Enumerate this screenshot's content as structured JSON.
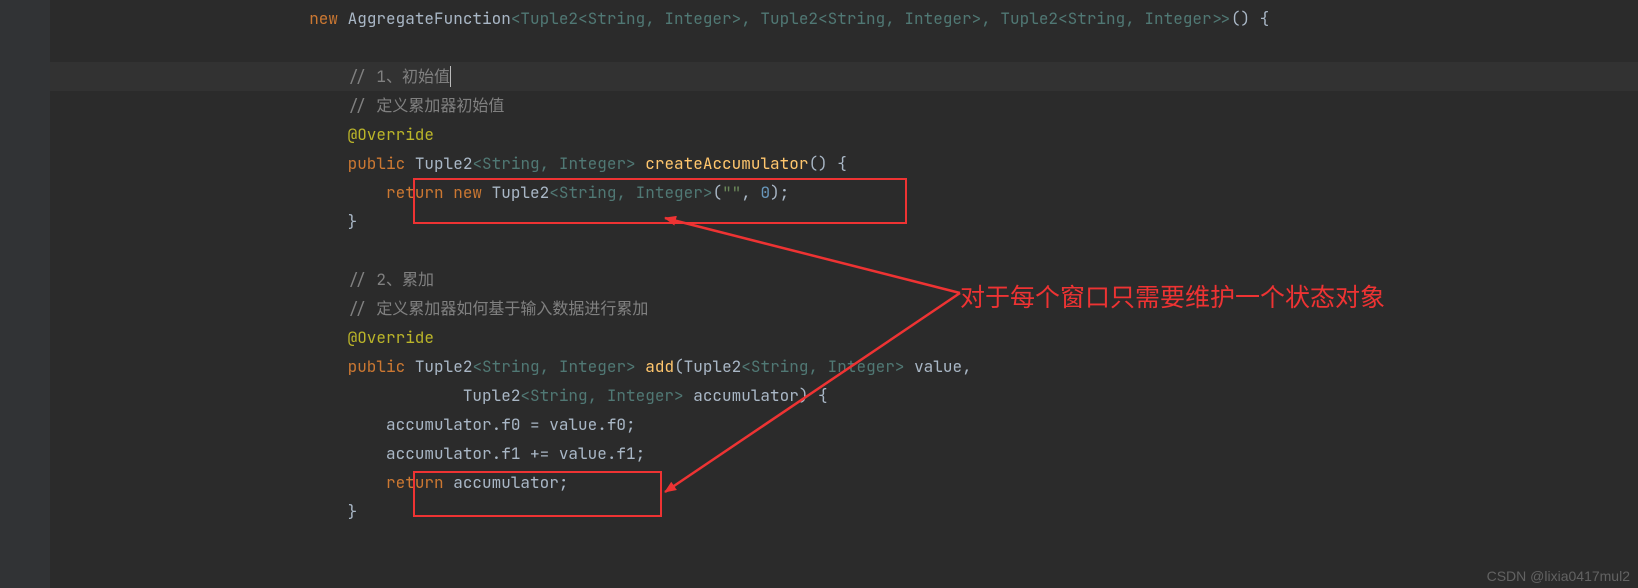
{
  "code": {
    "l1_pre": "                           ",
    "l1_kw": "new",
    "l1_sp": " ",
    "l1_cls": "AggregateFunction",
    "l1_gen": "<Tuple2<String, Integer>, Tuple2<String, Integer>, Tuple2<String, Integer>>",
    "l1_tail": "() {",
    "indent3": "                               ",
    "indent4": "                                   ",
    "indent5": "                                           ",
    "c1": "// 1、初始值",
    "c2": "// 定义累加器初始值",
    "at": "@Override",
    "m1_kw": "public",
    "m1_sp": " ",
    "m1_ret": "Tuple2",
    "m1_gen": "<String, Integer>",
    "m1_sp2": " ",
    "m1_name": "createAccumulator",
    "m1_tail": "() {",
    "r1_kw": "return new",
    "r1_sp": " ",
    "r1_t": "Tuple2",
    "r1_gen": "<String, Integer>",
    "r1_open": "(",
    "r1_str": "\"\"",
    "r1_mid": ", ",
    "r1_num": "0",
    "r1_end": ");",
    "brace": "}",
    "c3": "// 2、累加",
    "c4": "// 定义累加器如何基于输入数据进行累加",
    "m2_kw": "public",
    "m2_ret": "Tuple2",
    "m2_gen": "<String, Integer>",
    "m2_name": "add",
    "m2_open": "(",
    "m2_p1t": "Tuple2",
    "m2_p1g": "<String, Integer>",
    "m2_p1n": " value,",
    "m2b_t": "Tuple2",
    "m2b_g": "<String, Integer>",
    "m2b_n": " accumulator) {",
    "s1": "accumulator.f0 = value.f0;",
    "s2": "accumulator.f1 += value.f1;",
    "r2_kw": "return",
    "r2_sp": " ",
    "r2_v": "accumulator;"
  },
  "annotation": "对于每个窗口只需要维护一个状态对象",
  "watermark": "CSDN @lixia0417mul2"
}
